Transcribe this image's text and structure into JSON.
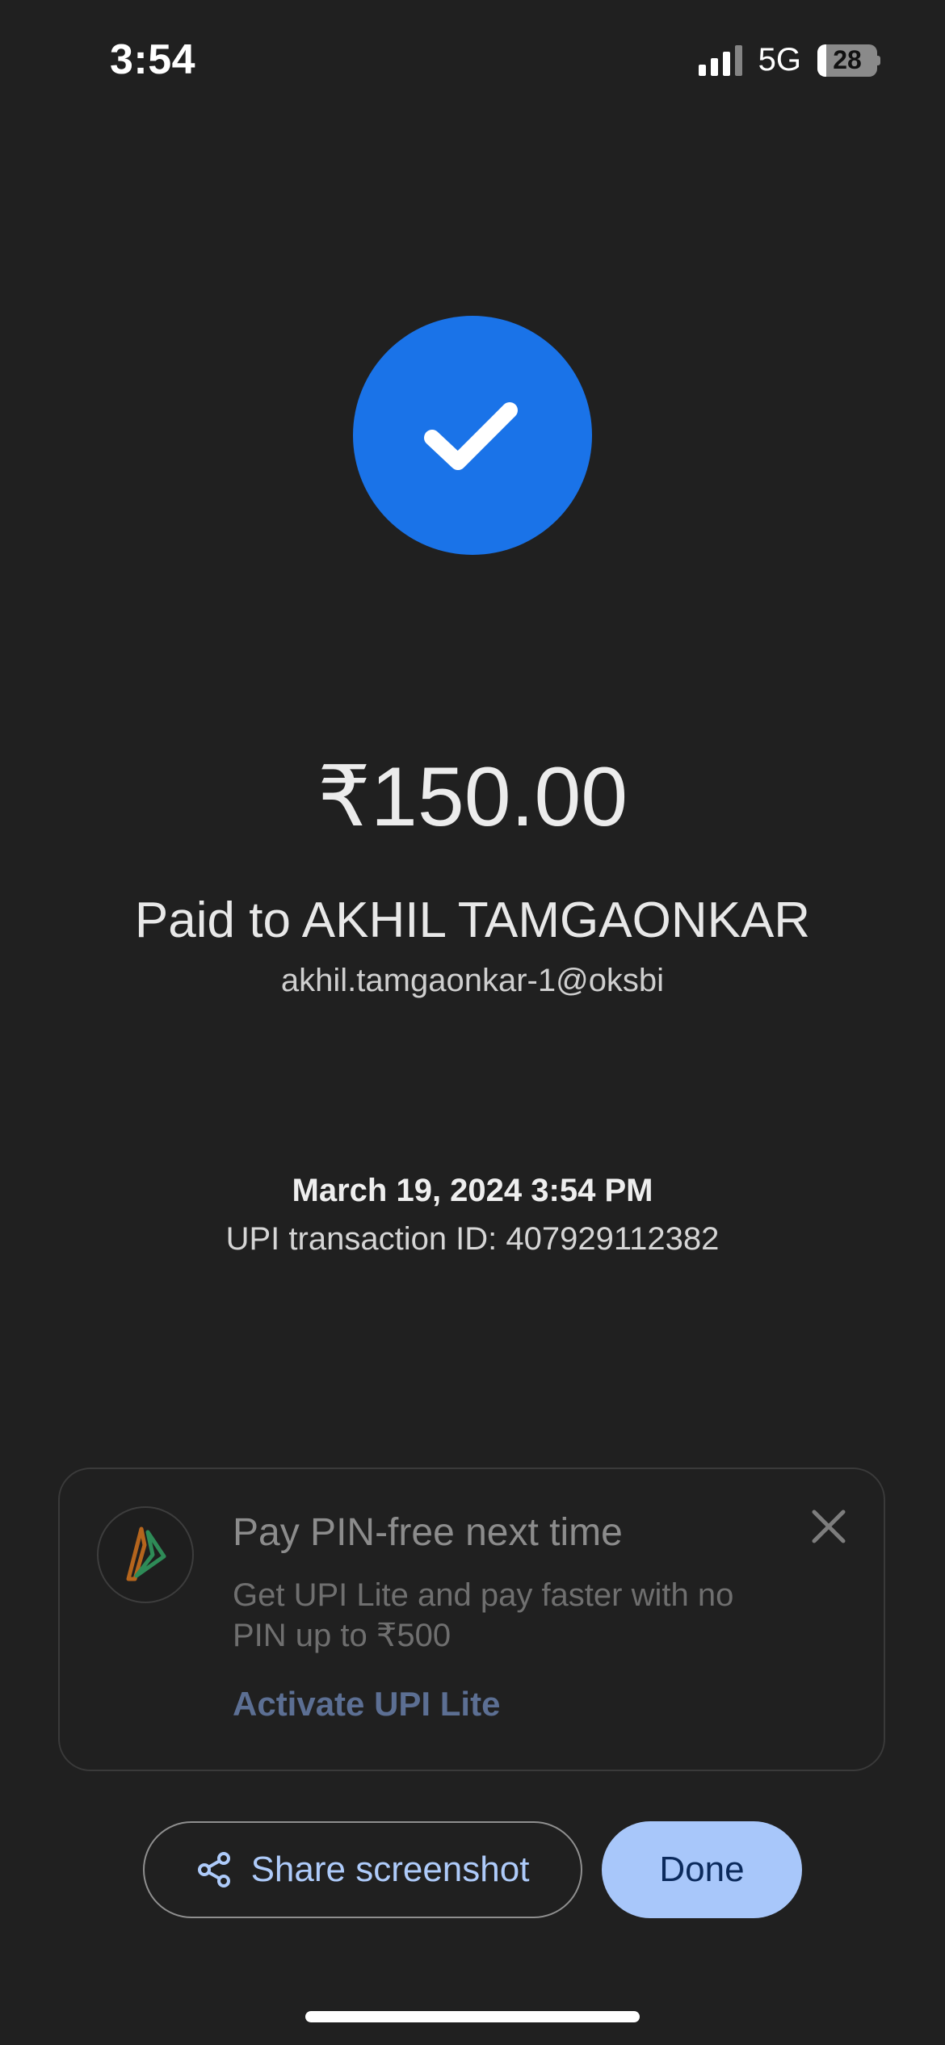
{
  "status_bar": {
    "time": "3:54",
    "network": "5G",
    "battery": "28",
    "battery_level": 0.28
  },
  "payment": {
    "amount": "₹150.00",
    "paid_to": "Paid to AKHIL TAMGAONKAR",
    "upi_id": "akhil.tamgaonkar-1@oksbi",
    "datetime": "March 19, 2024 3:54 PM",
    "transaction_id": "UPI transaction ID: 407929112382"
  },
  "promo": {
    "title": "Pay PIN-free next time",
    "description": "Get UPI Lite and pay faster with no PIN up to ₹500",
    "link": "Activate UPI Lite",
    "logo_icon": "upi-logo-icon",
    "close_icon": "close-icon"
  },
  "actions": {
    "share_label": "Share screenshot",
    "share_icon": "share-icon",
    "done_label": "Done"
  },
  "colors": {
    "background": "#202020",
    "success": "#1a73e8",
    "primary_button": "#a8c7fa",
    "link": "#5c6f93"
  }
}
